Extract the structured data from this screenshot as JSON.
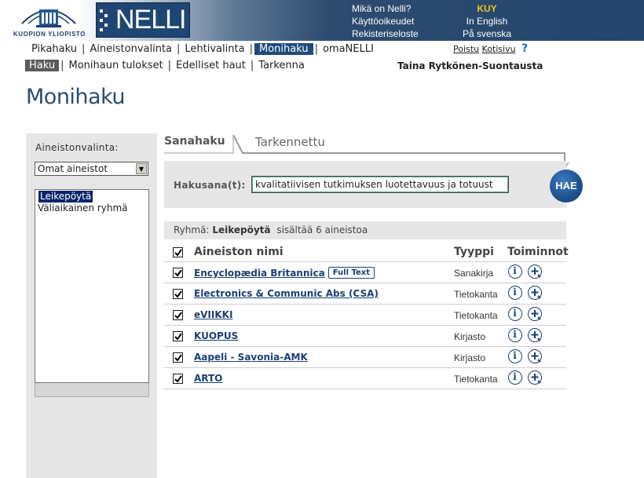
{
  "header": {
    "university_name": "KUOPION YLIOPISTO",
    "app_logo": "NELLI",
    "links_left": [
      "Mikä on Nelli?",
      "Käyttöoikeudet",
      "Rekisteriseloste"
    ],
    "org_code": "KUY",
    "links_right": [
      "In English",
      "På svenska"
    ]
  },
  "nav": {
    "main": [
      {
        "label": "Pikahaku",
        "active": false
      },
      {
        "label": "Aineistonvalinta",
        "active": false
      },
      {
        "label": "Lehtivalinta",
        "active": false
      },
      {
        "label": "Monihaku",
        "active": true
      },
      {
        "label": "omaNELLI",
        "active": false
      }
    ],
    "sub": [
      {
        "label": "Haku",
        "active": true
      },
      {
        "label": "Monihaun tulokset",
        "active": false
      },
      {
        "label": "Edelliset haut",
        "active": false
      },
      {
        "label": "Tarkenna",
        "active": false
      }
    ],
    "logout": "Poistu",
    "home": "Kotisivu",
    "help_symbol": "?",
    "user_name": "Taina Rytkönen-Suontausta"
  },
  "page_title": "Monihaku",
  "sidebar": {
    "label": "Aineistonvalinta:",
    "select_value": "Omat aineistot",
    "list": [
      "Leikepöytä",
      "Väliaikainen ryhmä"
    ],
    "selected_index": 0
  },
  "tabs": {
    "active": "Sanahaku",
    "inactive": "Tarkennettu"
  },
  "search": {
    "label": "Hakusana(t):",
    "value": "kvalitatiivisen tutkimuksen luotettavuus ja totuust",
    "button": "HAE"
  },
  "group": {
    "prefix": "Ryhmä:",
    "name": "Leikepöytä",
    "suffix": "sisältää 6 aineistoa"
  },
  "table": {
    "headers": {
      "name": "Aineiston nimi",
      "type": "Tyyppi",
      "actions": "Toiminnot"
    },
    "full_text_label": "Full Text",
    "rows": [
      {
        "name": "Encyclopædia Britannica",
        "type": "Sanakirja",
        "full_text": true
      },
      {
        "name": "Electronics & Communic Abs (CSA)",
        "type": "Tietokanta",
        "full_text": false
      },
      {
        "name": "eVIIKKI",
        "type": "Tietokanta",
        "full_text": false
      },
      {
        "name": "KUOPUS",
        "type": "Kirjasto",
        "full_text": false
      },
      {
        "name": "Aapeli - Savonia-AMK",
        "type": "Kirjasto",
        "full_text": false
      },
      {
        "name": "ARTO",
        "type": "Tietokanta",
        "full_text": false
      }
    ]
  },
  "colors": {
    "brand_blue": "#1f4a7a",
    "header_dark": "#24456d",
    "org_code": "#f0c419",
    "panel_grey": "#e6e6e6"
  }
}
